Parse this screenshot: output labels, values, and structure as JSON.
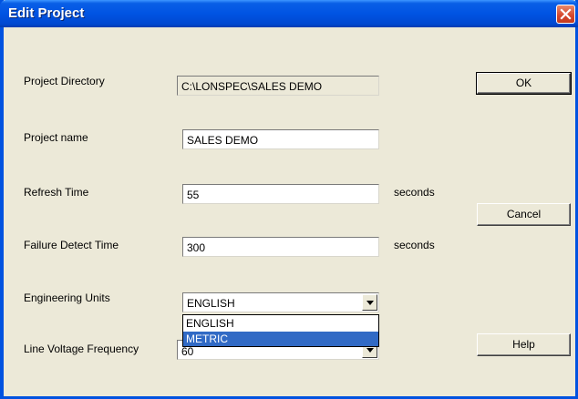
{
  "window": {
    "title": "Edit Project",
    "close_icon": "close-icon"
  },
  "fields": {
    "project_directory": {
      "label": "Project Directory",
      "value": "C:\\LONSPEC\\SALES DEMO"
    },
    "project_name": {
      "label": "Project name",
      "value": "SALES DEMO"
    },
    "refresh_time": {
      "label": "Refresh Time",
      "value": "55",
      "unit": "seconds"
    },
    "failure_detect_time": {
      "label": "Failure Detect Time",
      "value": "300",
      "unit": "seconds"
    },
    "engineering_units": {
      "label": "Engineering Units",
      "value": "ENGLISH",
      "options": [
        "ENGLISH",
        "METRIC"
      ],
      "highlighted": "METRIC"
    },
    "line_voltage_frequency": {
      "label": "Line Voltage Frequency",
      "value": "60"
    }
  },
  "buttons": {
    "ok": "OK",
    "cancel": "Cancel",
    "help": "Help"
  }
}
